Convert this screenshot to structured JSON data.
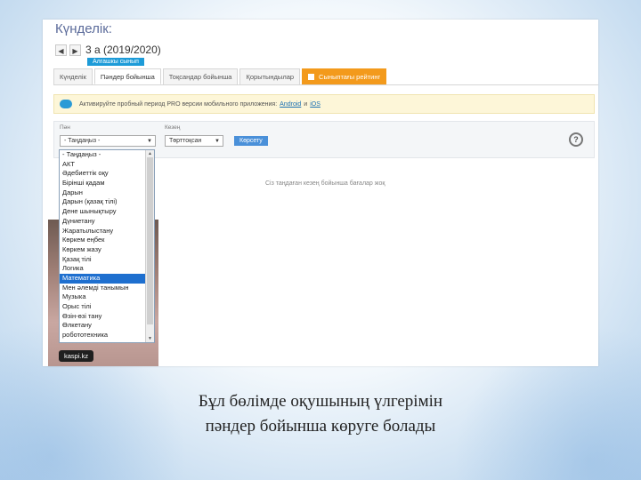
{
  "page": {
    "title": "Күнделік:",
    "class_name": "3 а (2019/2020)",
    "class_subtitle": "Алгашкы сынып",
    "nav_prev": "◀",
    "nav_next": "▶"
  },
  "tabs": [
    {
      "label": "Күнделік"
    },
    {
      "label": "Пәндер бойынша"
    },
    {
      "label": "Тоқсандар бойынша"
    },
    {
      "label": "Қорытындылар"
    },
    {
      "label": "Сыныптағы рейтинг"
    }
  ],
  "banner": {
    "text": "Активируйте пробный период PRO версии мобильного приложения:",
    "link1": "Android",
    "conj": "и",
    "link2": "iOS"
  },
  "filters": {
    "subject_label": "Пән",
    "subject_value": "- Таңдаңыз -",
    "quarter_label": "Кезең",
    "quarter_value": "Төрттоқсан",
    "show_button": "Көрсету",
    "help_icon": "?"
  },
  "no_data_text": "Сіз таңдаған кезең бойынша бағалар жоқ",
  "subject_options": [
    "- Таңдаңыз -",
    "АКТ",
    "Әдебиеттік оқу",
    "Бірінші қадам",
    "Дарын",
    "Дарын (қазақ тілі)",
    "Дене шынықтыру",
    "Дүниетану",
    "Жаратылыстану",
    "Көркем еңбек",
    "Көркем жазу",
    "Қазақ тілі",
    "Логика",
    "Математика",
    "Мен әлемді танымын",
    "Музыка",
    "Орыс тілі",
    "Өзін-өзі тану",
    "Өлкетану",
    "робототехника"
  ],
  "selected_subject_index": 13,
  "video_brand": "kaspi.kz",
  "video_header_letter": "Б",
  "caption_line1": "Бұл бөлімде оқушының үлгерімін",
  "caption_line2": "пәндер бойынша көруге  болады",
  "colors": {
    "accent": "#1e6fcf",
    "orange_tab": "#f39a1c",
    "title": "#5b6b9a"
  }
}
